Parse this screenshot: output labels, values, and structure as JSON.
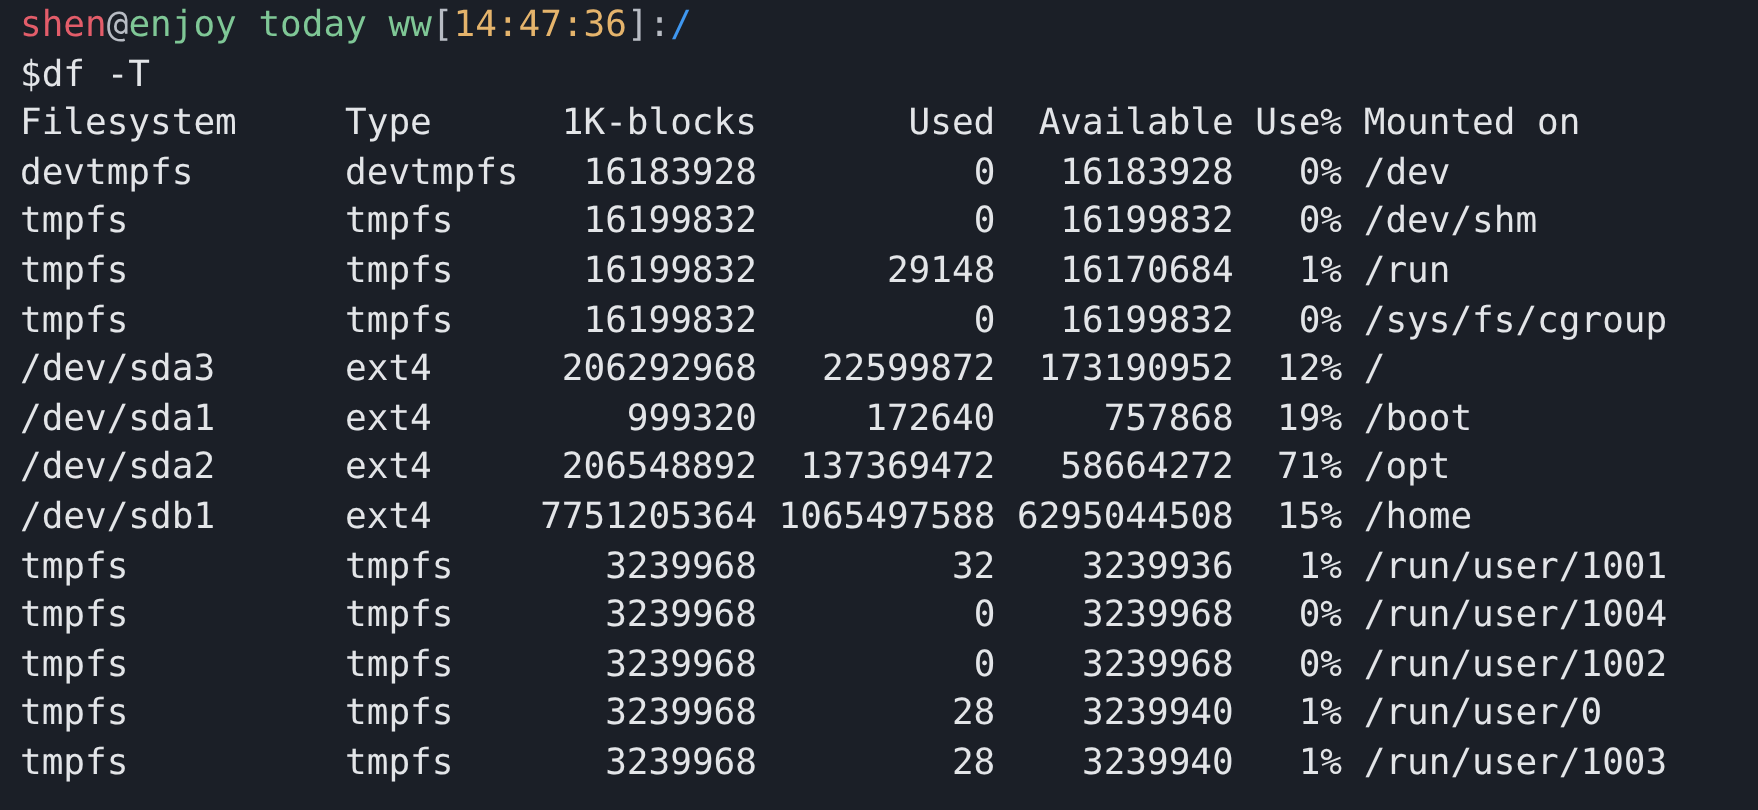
{
  "prompt": {
    "user": "shen",
    "at": "@",
    "host": "enjoy today ww",
    "time_open": "[",
    "time": "14:47:36",
    "time_close": "]",
    "separator": ":",
    "path": "/"
  },
  "command": "$df -T",
  "table": {
    "columns": [
      "Filesystem",
      "Type",
      "1K-blocks",
      "Used",
      "Available",
      "Use%",
      "Mounted on"
    ],
    "rows": [
      [
        "devtmpfs",
        "devtmpfs",
        "16183928",
        "0",
        "16183928",
        "0%",
        "/dev"
      ],
      [
        "tmpfs",
        "tmpfs",
        "16199832",
        "0",
        "16199832",
        "0%",
        "/dev/shm"
      ],
      [
        "tmpfs",
        "tmpfs",
        "16199832",
        "29148",
        "16170684",
        "1%",
        "/run"
      ],
      [
        "tmpfs",
        "tmpfs",
        "16199832",
        "0",
        "16199832",
        "0%",
        "/sys/fs/cgroup"
      ],
      [
        "/dev/sda3",
        "ext4",
        "206292968",
        "22599872",
        "173190952",
        "12%",
        "/"
      ],
      [
        "/dev/sda1",
        "ext4",
        "999320",
        "172640",
        "757868",
        "19%",
        "/boot"
      ],
      [
        "/dev/sda2",
        "ext4",
        "206548892",
        "137369472",
        "58664272",
        "71%",
        "/opt"
      ],
      [
        "/dev/sdb1",
        "ext4",
        "7751205364",
        "1065497588",
        "6295044508",
        "15%",
        "/home"
      ],
      [
        "tmpfs",
        "tmpfs",
        "3239968",
        "32",
        "3239936",
        "1%",
        "/run/user/1001"
      ],
      [
        "tmpfs",
        "tmpfs",
        "3239968",
        "0",
        "3239968",
        "0%",
        "/run/user/1004"
      ],
      [
        "tmpfs",
        "tmpfs",
        "3239968",
        "0",
        "3239968",
        "0%",
        "/run/user/1002"
      ],
      [
        "tmpfs",
        "tmpfs",
        "3239968",
        "28",
        "3239940",
        "1%",
        "/run/user/0"
      ],
      [
        "tmpfs",
        "tmpfs",
        "3239968",
        "28",
        "3239940",
        "1%",
        "/run/user/1003"
      ]
    ]
  }
}
